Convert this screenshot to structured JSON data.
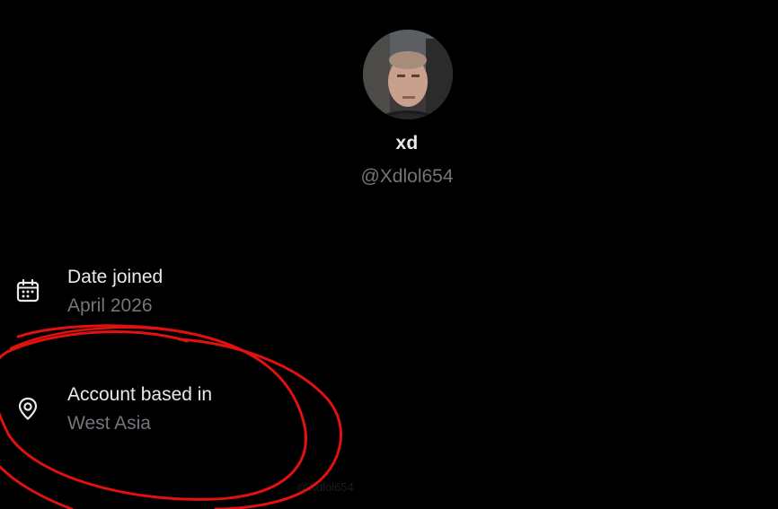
{
  "profile": {
    "display_name": "xd",
    "handle": "@Xdlol654",
    "avatar_icon": "profile-photo"
  },
  "info": {
    "joined": {
      "icon": "calendar-icon",
      "label": "Date joined",
      "value": "April 2026"
    },
    "location": {
      "icon": "location-pin-icon",
      "label": "Account based in",
      "value": "West Asia"
    }
  },
  "footer": {
    "faint_handle": "@Xdlol654"
  },
  "colors": {
    "background": "#000000",
    "primary_text": "#e7e9ea",
    "secondary_text": "#71767b",
    "annotation": "#e0120f"
  }
}
